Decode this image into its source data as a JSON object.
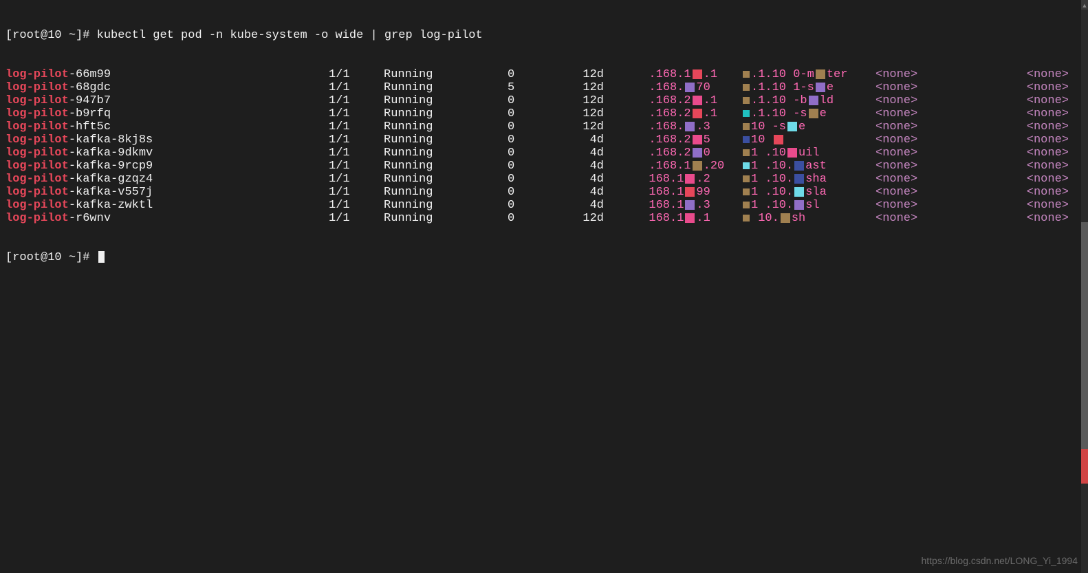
{
  "prompt1": {
    "user_host": "[root@10 ~]#",
    "command": " kubectl get pod -n kube-system -o wide | grep log-pilot"
  },
  "rows": [
    {
      "name_prefix": "log-pilot",
      "name_suffix": "-66m99",
      "ready": "1/1",
      "status": "Running",
      "restarts": "0",
      "age": "12d",
      "ipfrag1": ".168.1",
      "ipfrag2": ".1",
      "nodefrag1": ".1.10",
      "nodefrag2": "0-m",
      "nodefrag3": "ter",
      "nominated": "<none>",
      "readiness": "<none>",
      "c1": "#e6475a",
      "c2": "#a08050",
      "c3": "#a08050"
    },
    {
      "name_prefix": "log-pilot",
      "name_suffix": "-68gdc",
      "ready": "1/1",
      "status": "Running",
      "restarts": "5",
      "age": "12d",
      "ipfrag1": ".168.",
      "ipfrag2": "70",
      "nodefrag1": ".1.10",
      "nodefrag2": "1-s",
      "nodefrag3": "e",
      "nominated": "<none>",
      "readiness": "<none>",
      "c1": "#906ec7",
      "c2": "#a08050",
      "c3": "#906ec7"
    },
    {
      "name_prefix": "log-pilot",
      "name_suffix": "-947b7",
      "ready": "1/1",
      "status": "Running",
      "restarts": "0",
      "age": "12d",
      "ipfrag1": ".168.2",
      "ipfrag2": ".1",
      "nodefrag1": ".1.10",
      "nodefrag2": "-b",
      "nodefrag3": "ld",
      "nominated": "<none>",
      "readiness": "<none>",
      "c1": "#e94b8c",
      "c2": "#a08050",
      "c3": "#906ec7"
    },
    {
      "name_prefix": "log-pilot",
      "name_suffix": "-b9rfq",
      "ready": "1/1",
      "status": "Running",
      "restarts": "0",
      "age": "12d",
      "ipfrag1": ".168.2",
      "ipfrag2": ".1",
      "nodefrag1": ".1.10",
      "nodefrag2": "-s",
      "nodefrag3": "e",
      "nominated": "<none>",
      "readiness": "<none>",
      "c1": "#e6475a",
      "c2": "#20c0c0",
      "c3": "#a08050"
    },
    {
      "name_prefix": "log-pilot",
      "name_suffix": "-hft5c",
      "ready": "1/1",
      "status": "Running",
      "restarts": "0",
      "age": "12d",
      "ipfrag1": ".168.",
      "ipfrag2": ".3",
      "nodefrag1": "10",
      "nodefrag2": "-s",
      "nodefrag3": "e",
      "nominated": "<none>",
      "readiness": "<none>",
      "c1": "#906ec7",
      "c2": "#a08050",
      "c3": "#6edbe8"
    },
    {
      "name_prefix": "log-pilot",
      "name_suffix": "-kafka-8kj8s",
      "ready": "1/1",
      "status": "Running",
      "restarts": "0",
      "age": "4d",
      "ipfrag1": ".168.2",
      "ipfrag2": "5",
      "nodefrag1": "10",
      "nodefrag2": "",
      "nodefrag3": "",
      "nominated": "<none>",
      "readiness": "<none>",
      "c1": "#e94b8c",
      "c2": "#3b4fa0",
      "c3": "#e6475a"
    },
    {
      "name_prefix": "log-pilot",
      "name_suffix": "-kafka-9dkmv",
      "ready": "1/1",
      "status": "Running",
      "restarts": "0",
      "age": "4d",
      "ipfrag1": ".168.2",
      "ipfrag2": "0",
      "nodefrag1": "1",
      "nodefrag2": ".10",
      "nodefrag3": "uil",
      "nominated": "<none>",
      "readiness": "<none>",
      "c1": "#906ec7",
      "c2": "#a08050",
      "c3": "#e94b8c"
    },
    {
      "name_prefix": "log-pilot",
      "name_suffix": "-kafka-9rcp9",
      "ready": "1/1",
      "status": "Running",
      "restarts": "0",
      "age": "4d",
      "ipfrag1": ".168.1",
      "ipfrag2": ".20",
      "nodefrag1": "1",
      "nodefrag2": ".10.",
      "nodefrag3": "ast",
      "nominated": "<none>",
      "readiness": "<none>",
      "c1": "#a08050",
      "c2": "#6edbe8",
      "c3": "#3b4fa0"
    },
    {
      "name_prefix": "log-pilot",
      "name_suffix": "-kafka-gzqz4",
      "ready": "1/1",
      "status": "Running",
      "restarts": "0",
      "age": "4d",
      "ipfrag1": "168.1",
      "ipfrag2": ".2",
      "nodefrag1": "1",
      "nodefrag2": ".10.",
      "nodefrag3": "sha",
      "nominated": "<none>",
      "readiness": "<none>",
      "c1": "#e94b8c",
      "c2": "#a08050",
      "c3": "#3b4fa0"
    },
    {
      "name_prefix": "log-pilot",
      "name_suffix": "-kafka-v557j",
      "ready": "1/1",
      "status": "Running",
      "restarts": "0",
      "age": "4d",
      "ipfrag1": "168.1",
      "ipfrag2": "99",
      "nodefrag1": "1",
      "nodefrag2": ".10.",
      "nodefrag3": "sla",
      "nominated": "<none>",
      "readiness": "<none>",
      "c1": "#e6475a",
      "c2": "#a08050",
      "c3": "#6edbe8"
    },
    {
      "name_prefix": "log-pilot",
      "name_suffix": "-kafka-zwktl",
      "ready": "1/1",
      "status": "Running",
      "restarts": "0",
      "age": "4d",
      "ipfrag1": "168.1",
      "ipfrag2": ".3",
      "nodefrag1": "1",
      "nodefrag2": ".10.",
      "nodefrag3": "sl",
      "nominated": "<none>",
      "readiness": "<none>",
      "c1": "#906ec7",
      "c2": "#a08050",
      "c3": "#906ec7"
    },
    {
      "name_prefix": "log-pilot",
      "name_suffix": "-r6wnv",
      "ready": "1/1",
      "status": "Running",
      "restarts": "0",
      "age": "12d",
      "ipfrag1": "168.1",
      "ipfrag2": ".1",
      "nodefrag1": "",
      "nodefrag2": "10.",
      "nodefrag3": "sh",
      "nominated": "<none>",
      "readiness": "<none>",
      "c1": "#e94b8c",
      "c2": "#a08050",
      "c3": "#a08050"
    }
  ],
  "prompt2": "[root@10 ~]# ",
  "watermark": "https://blog.csdn.net/LONG_Yi_1994"
}
